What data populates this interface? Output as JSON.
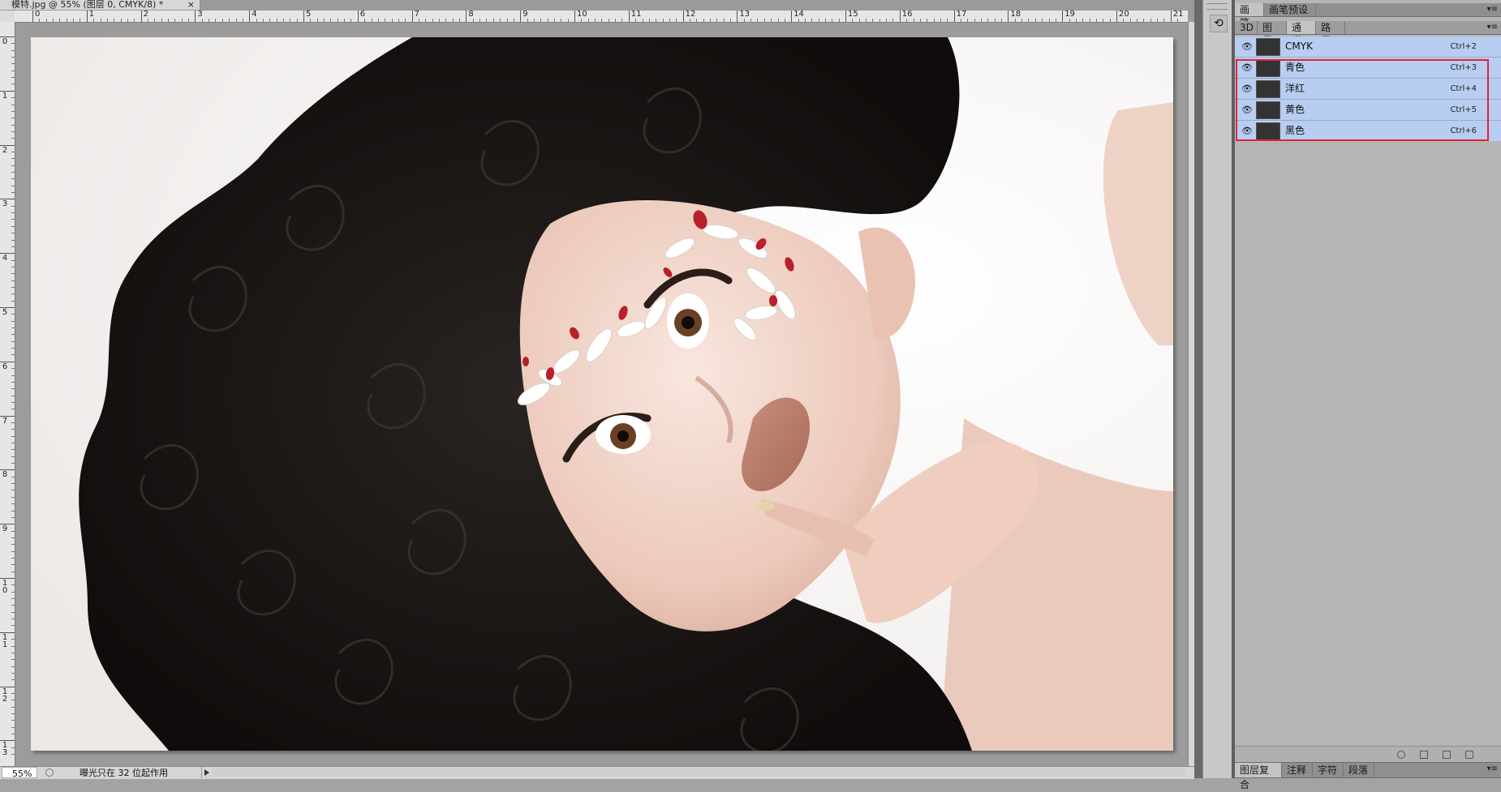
{
  "document": {
    "tab_title": "模特.jpg @ 55% (图层 0, CMYK/8) *",
    "close_glyph": "×",
    "ruler_top_labels": [
      "0",
      "1",
      "2",
      "3",
      "4",
      "5",
      "6",
      "7",
      "8",
      "9",
      "10",
      "11",
      "12",
      "13",
      "14",
      "15",
      "16",
      "17",
      "18",
      "19",
      "20",
      "21"
    ],
    "ruler_left_labels": [
      "0",
      "1",
      "2",
      "3",
      "4",
      "5",
      "6",
      "7",
      "8",
      "9",
      "10",
      "11",
      "12",
      "13"
    ]
  },
  "statusbar": {
    "zoom": "55%",
    "message": "曝光只在 32 位起作用"
  },
  "panel": {
    "top_tabs": [
      {
        "label": "画笔",
        "active": true
      },
      {
        "label": "画笔预设",
        "active": false
      }
    ],
    "sub_tabs": [
      {
        "label": "3D",
        "active": false
      },
      {
        "label": "图层",
        "active": false
      },
      {
        "label": "通道",
        "active": true
      },
      {
        "label": "路径",
        "active": false
      }
    ],
    "menu_glyph": "▾≡",
    "channels": [
      {
        "name": "CMYK",
        "shortcut": "Ctrl+2",
        "visible": true
      },
      {
        "name": "青色",
        "shortcut": "Ctrl+3",
        "visible": true
      },
      {
        "name": "洋红",
        "shortcut": "Ctrl+4",
        "visible": true
      },
      {
        "name": "黄色",
        "shortcut": "Ctrl+5",
        "visible": true
      },
      {
        "name": "黑色",
        "shortcut": "Ctrl+6",
        "visible": true
      }
    ],
    "bottom_tabs": [
      {
        "label": "图层复合",
        "active": true
      },
      {
        "label": "注释",
        "active": false
      },
      {
        "label": "字符",
        "active": false
      },
      {
        "label": "段落",
        "active": false
      }
    ],
    "highlight_color": "#e0262d",
    "selection_color": "#b7cdf1"
  }
}
